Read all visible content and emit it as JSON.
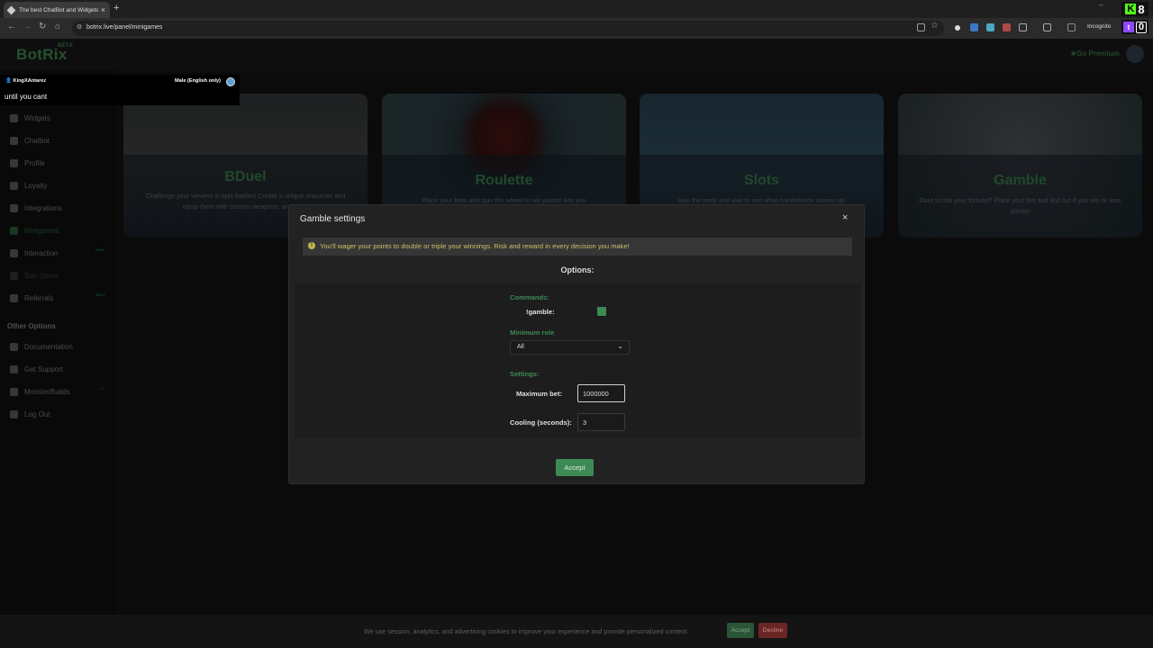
{
  "browser": {
    "tab_title": "The best ChatBot and Widgets",
    "url": "botrix.live/panel/minigames",
    "incognito_label": "Incognito"
  },
  "badges": {
    "kick_count": "8",
    "twitch_count": "0"
  },
  "app": {
    "logo": "BotRix",
    "logo_tag": "BETA",
    "premium_label": "Go Premium"
  },
  "sidebar": {
    "items": [
      {
        "label": "Widgets",
        "icon": "widgets-icon"
      },
      {
        "label": "Chatbot",
        "icon": "chatbot-icon"
      },
      {
        "label": "Profile",
        "icon": "profile-icon"
      },
      {
        "label": "Loyalty",
        "icon": "trophy-icon"
      },
      {
        "label": "Integrations",
        "icon": "integrations-icon"
      },
      {
        "label": "Minigames",
        "icon": "gamepad-icon"
      },
      {
        "label": "Interaction",
        "icon": "interaction-icon",
        "tag": "NEW"
      },
      {
        "label": "Sub-Users",
        "icon": "sub-users-icon"
      },
      {
        "label": "Referrals",
        "icon": "referrals-icon",
        "tag": "BETA"
      }
    ],
    "other_heading": "Other Options",
    "other_items": [
      {
        "label": "Documentation",
        "icon": "documentation-icon"
      },
      {
        "label": "Get Support",
        "icon": "support-icon"
      },
      {
        "label": "MonsterBuilds",
        "icon": "monsterbuilds-icon",
        "tag": "AD"
      },
      {
        "label": "Log Out",
        "icon": "logout-icon"
      }
    ]
  },
  "games": [
    {
      "title": "BDuel",
      "desc": "Challenge your viewers in epic battles! Create a unique character and equip them with custom weapons, and pets."
    },
    {
      "title": "Roulette",
      "desc": "Place your bets and spin the wheel to win points! Are you"
    },
    {
      "title": "Slots",
      "desc": "Spin the reels and wait to see what combination comes up!"
    },
    {
      "title": "Gamble",
      "desc": "Dare to risk your fortune? Place your bet and find out if you win or lose points!"
    }
  ],
  "overlay": {
    "user": "KingXAntarez",
    "voice": "Male (English only)",
    "message": "until you cant"
  },
  "modal": {
    "title": "Gamble settings",
    "close_glyph": "×",
    "info": "You'll wager your points to double or triple your winnings. Risk and reward in every decision you make!",
    "options_label": "Options:",
    "commands_label": "Commands:",
    "command_name": "!gamble:",
    "command_enabled": true,
    "min_role_label": "Minimum role",
    "min_role_value": "All",
    "settings_label": "Settings:",
    "max_bet_label": "Maximum bet:",
    "max_bet_value": "1000000",
    "cooling_label": "Cooling (seconds):",
    "cooling_value": "3",
    "accept_label": "Accept"
  },
  "cookie": {
    "text": "We use session, analytics, and advertising cookies to improve your experience and provide personalized content.",
    "accept": "Accept",
    "decline": "Decline"
  },
  "colors": {
    "accent": "#3e8a55",
    "alert_text": "#c9c06a",
    "decline": "#6a2525"
  }
}
